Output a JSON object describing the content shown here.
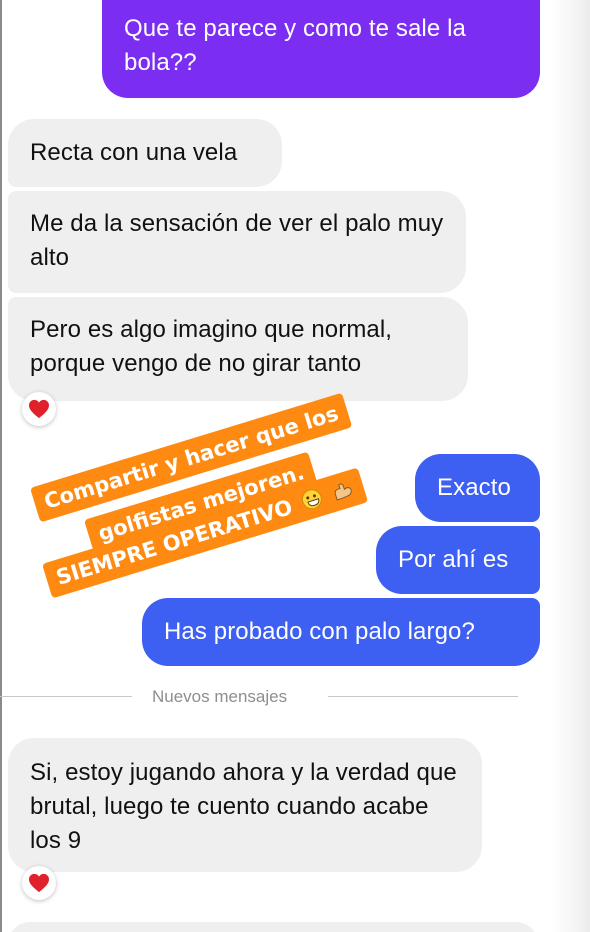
{
  "messages": {
    "m1": "Que te parece y como te sale la bola??",
    "m2": "Recta con una vela",
    "m3": "Me da la sensación de ver el palo muy alto",
    "m4": "Pero es algo imagino que normal, porque vengo de no girar tanto",
    "m5": "Exacto",
    "m6": "Por ahí es",
    "m7": "Has probado con palo largo?",
    "m8": "Si, estoy jugando ahora y la verdad que brutal, luego te cuento cuando acabe los 9"
  },
  "divider": {
    "label": "Nuevos mensajes"
  },
  "sticker": {
    "line1": "Compartir y hacer que los",
    "line2": "golfistas mejoren.",
    "line3": "SIEMPRE OPERATIVO"
  },
  "colors": {
    "outgoing_purple": "#7b2ef2",
    "outgoing_blue": "#3d5ff2",
    "incoming": "#efefef",
    "sticker": "#ff8a12",
    "heart": "#e0202a"
  },
  "icons": {
    "reaction": "heart-icon",
    "sticker_emoji_1": "grinning-face-icon",
    "sticker_emoji_2": "flexed-biceps-icon"
  }
}
